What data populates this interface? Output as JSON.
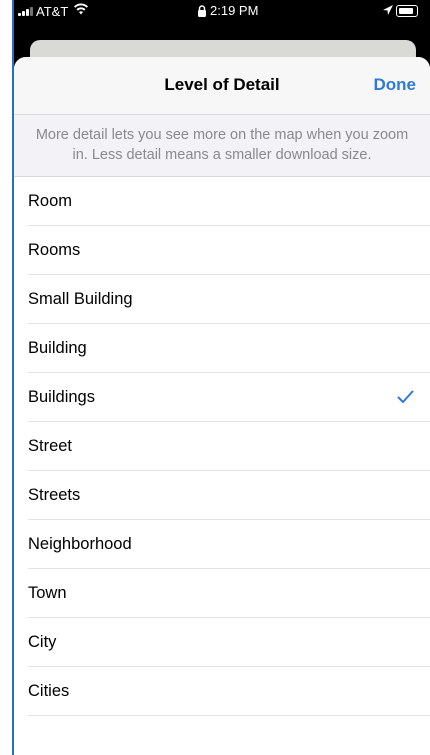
{
  "status_bar": {
    "carrier": "AT&T",
    "time": "2:19 PM"
  },
  "nav": {
    "title": "Level of Detail",
    "done_label": "Done"
  },
  "description": "More detail lets you see more on the map when you zoom in. Less detail means a smaller download size.",
  "options": [
    {
      "label": "Room",
      "selected": false
    },
    {
      "label": "Rooms",
      "selected": false
    },
    {
      "label": "Small Building",
      "selected": false
    },
    {
      "label": "Building",
      "selected": false
    },
    {
      "label": "Buildings",
      "selected": true
    },
    {
      "label": "Street",
      "selected": false
    },
    {
      "label": "Streets",
      "selected": false
    },
    {
      "label": "Neighborhood",
      "selected": false
    },
    {
      "label": "Town",
      "selected": false
    },
    {
      "label": "City",
      "selected": false
    },
    {
      "label": "Cities",
      "selected": false
    }
  ],
  "colors": {
    "accent": "#2f7ad6",
    "secondary_text": "#8a8a8e"
  },
  "icons": [
    "signal-icon",
    "wifi-icon",
    "lock-icon",
    "location-arrow-icon",
    "battery-icon",
    "checkmark-icon"
  ]
}
